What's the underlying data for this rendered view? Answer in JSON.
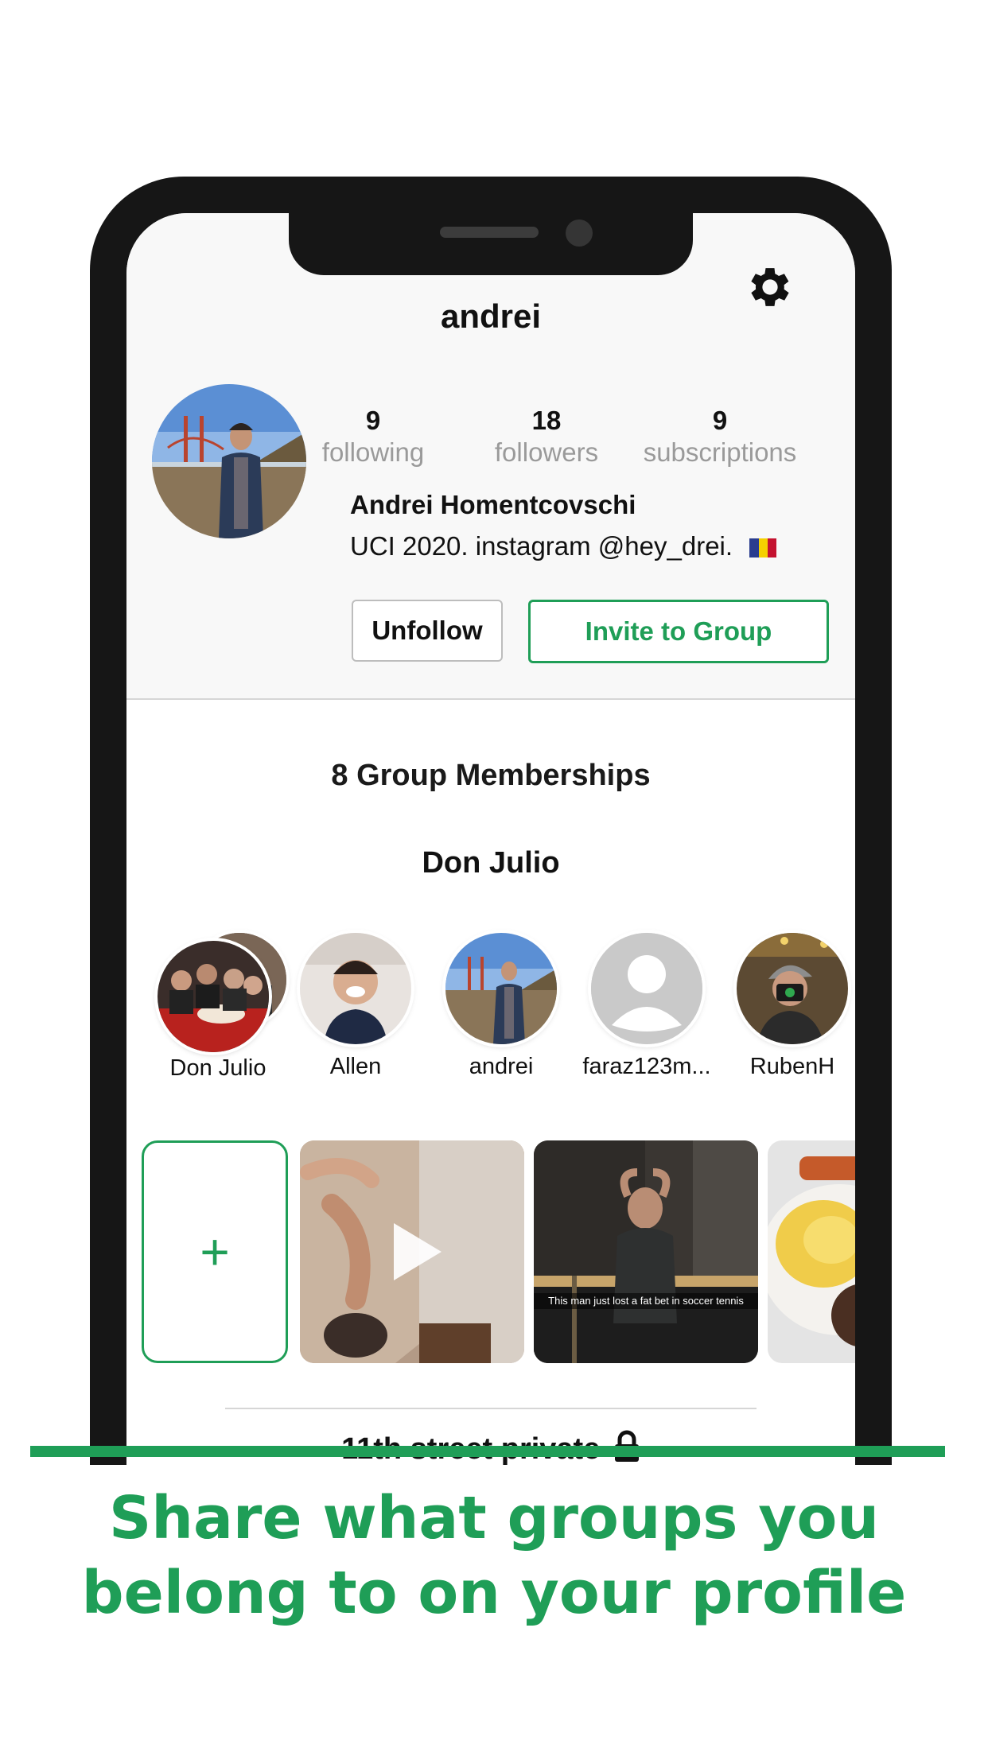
{
  "profile": {
    "username": "andrei",
    "stats": [
      {
        "count": "9",
        "label": "following"
      },
      {
        "count": "18",
        "label": "followers"
      },
      {
        "count": "9",
        "label": "subscriptions"
      }
    ],
    "full_name": "Andrei Homentcovschi",
    "bio": "UCI 2020. instagram @hey_drei.",
    "unfollow_label": "Unfollow",
    "invite_label": "Invite to Group"
  },
  "groups": {
    "memberships_title": "8 Group Memberships",
    "current_group": "Don Julio",
    "members": [
      {
        "name": "Don Julio"
      },
      {
        "name": "Allen"
      },
      {
        "name": "andrei"
      },
      {
        "name": "faraz123m..."
      },
      {
        "name": "RubenH"
      }
    ],
    "add_label": "+",
    "media": [
      {
        "type": "video"
      },
      {
        "type": "photo",
        "caption": "This man just lost a fat bet in soccer tennis"
      },
      {
        "type": "photo"
      }
    ],
    "next_group": "11th street private"
  },
  "tagline": {
    "line1": "Share what groups you",
    "line2": "belong to on your profile"
  },
  "colors": {
    "accent": "#1f9e57",
    "frame": "#161616"
  },
  "icons": [
    "gear-icon",
    "play-icon",
    "lock-icon",
    "plus-icon"
  ]
}
